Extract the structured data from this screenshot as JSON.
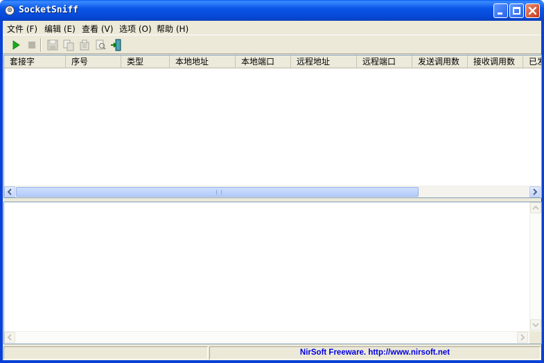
{
  "window": {
    "title": "SocketSniff",
    "icon": "app-icon"
  },
  "menu": [
    {
      "label": "文件 (F)"
    },
    {
      "label": "编辑 (E)"
    },
    {
      "label": "查看 (V)"
    },
    {
      "label": "选项 (O)"
    },
    {
      "label": "帮助 (H)"
    }
  ],
  "toolbar": {
    "icons": [
      "play-icon",
      "stop-icon",
      "save-icon",
      "copy-icon",
      "properties-icon",
      "find-icon",
      "exit-icon"
    ]
  },
  "columns": [
    "套接字",
    "序号",
    "类型",
    "本地地址",
    "本地端口",
    "远程地址",
    "远程端口",
    "发送调用数",
    "接收调用数",
    "已发"
  ],
  "status": {
    "text": "NirSoft Freeware.  http://www.nirsoft.net"
  },
  "colors": {
    "title_bar": "#0841d8",
    "accent_green": "#1aab1a",
    "status_text": "#0000e0"
  }
}
